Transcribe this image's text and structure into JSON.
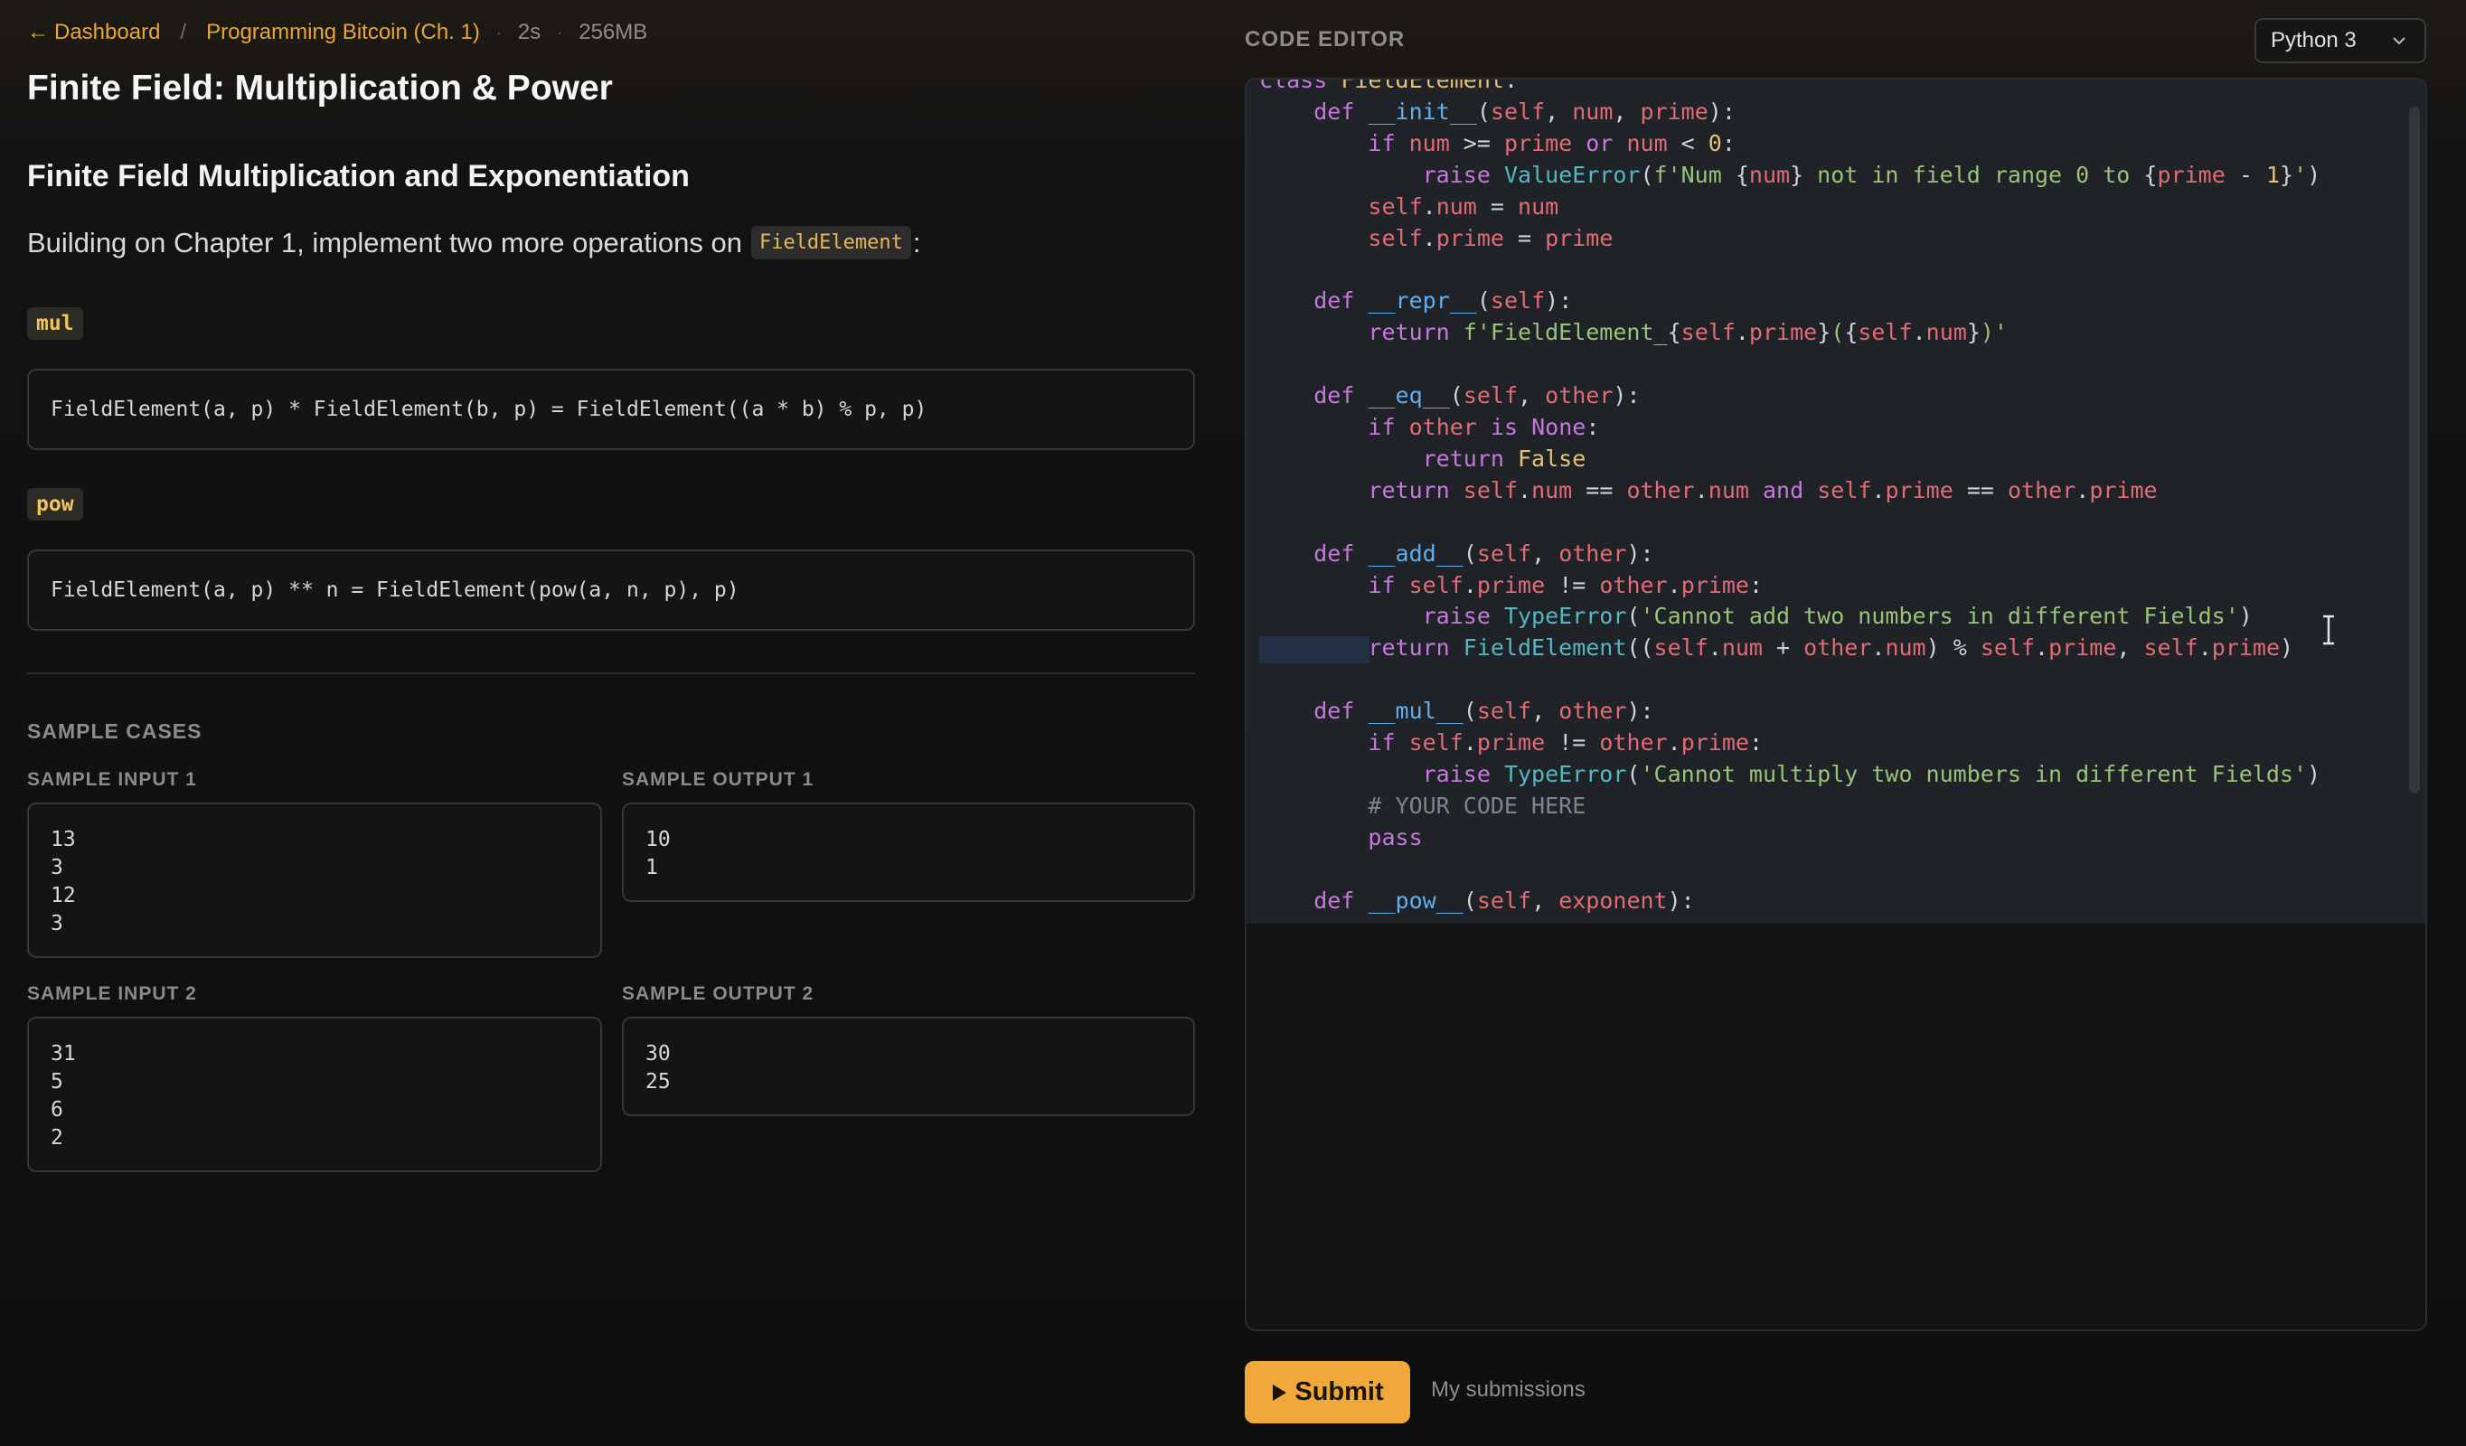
{
  "breadcrumb": {
    "back_label": "Dashboard",
    "separator": "/",
    "course": "Programming Bitcoin (Ch. 1)",
    "time_limit": "2s",
    "memory_limit": "256MB"
  },
  "page_title": "Finite Field: Multiplication & Power",
  "section_title": "Finite Field Multiplication and Exponentiation",
  "intro": {
    "text": "Building on Chapter 1, implement two more operations on",
    "code": "FieldElement",
    "suffix": ":"
  },
  "operations": [
    {
      "tag": "mul",
      "formula": "FieldElement(a, p) * FieldElement(b, p) = FieldElement((a * b) % p, p)"
    },
    {
      "tag": "pow",
      "formula": "FieldElement(a, p) ** n = FieldElement(pow(a, n, p), p)"
    }
  ],
  "samples": {
    "heading": "SAMPLE CASES",
    "cases": [
      {
        "input_label": "SAMPLE INPUT 1",
        "input": "13\n3\n12\n3",
        "output_label": "SAMPLE OUTPUT 1",
        "output": "10\n1"
      },
      {
        "input_label": "SAMPLE INPUT 2",
        "input": "31\n5\n6\n2",
        "output_label": "SAMPLE OUTPUT 2",
        "output": "30\n25"
      }
    ]
  },
  "editor": {
    "heading": "CODE EDITOR",
    "language": "Python 3"
  },
  "actions": {
    "submit_label": "Submit",
    "submissions_link": "My submissions"
  },
  "colors": {
    "accent": "#f0a83a",
    "keyword": "#c678dd",
    "function": "#61afef",
    "string": "#98c379"
  }
}
